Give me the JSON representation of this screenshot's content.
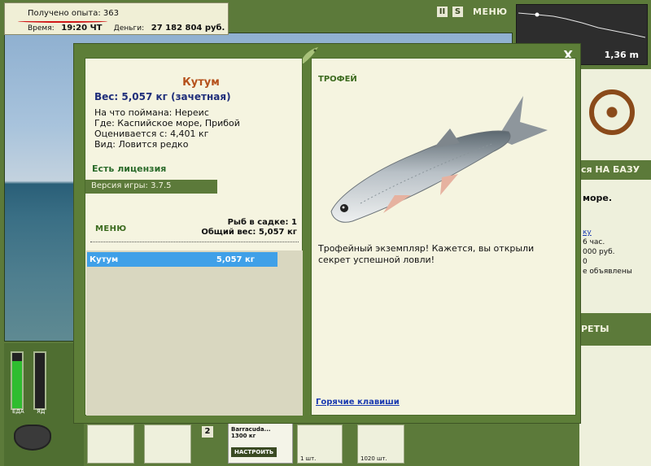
{
  "status": {
    "xp_text": "Получено опыта: 363",
    "time_label": "Время:",
    "time_value": "19:20 ЧТ",
    "money_label": "Деньги:",
    "money_value": "27 182 804 руб."
  },
  "top_menu": {
    "pause_icon": "pause-icon",
    "s_label": "S",
    "menu_label": "МЕНЮ"
  },
  "depth": {
    "value": "1,36 m"
  },
  "right_panel": {
    "base_label": "ся НА БАЗУ",
    "sea_text": "море.",
    "line1": "ку",
    "line2": "6 час.",
    "line3": "000 руб.",
    "line4": "0",
    "line5": "е объявлены",
    "secrets_label": "РЕТЫ"
  },
  "gauges": {
    "food_label": "ЕДА",
    "poison_label": "ЯД",
    "food_fill": 0.85,
    "poison_fill": 0.0
  },
  "bottom_bar": {
    "slot_num": "2",
    "tackle_name": "Barracuda...",
    "tackle_weight": "1300 кг",
    "setup_button": "НАСТРОИТЬ",
    "hook_count": "1 шт.",
    "bait_count": "1020 шт."
  },
  "modal": {
    "close_label": "X",
    "fish_name": "Кутум",
    "fish_weight": "Вес: 5,057 кг (зачетная)",
    "caught_on": "На что поймана: Нереис",
    "location": "Где: Каспийское море, Прибой",
    "valued_from": "Оценивается с: 4,401 кг",
    "species": "Вид: Ловится редко",
    "license": "Есть лицензия",
    "version": "Версия игры: 3.7.5",
    "menu_label": "МЕНЮ",
    "fish_in_cage": "Рыб в садке: 1",
    "total_weight": "Общий вес: 5,057 кг",
    "catch_list": [
      {
        "name": "Кутум",
        "weight": "5,057 кг"
      }
    ],
    "trophy_label": "ТРОФЕЙ",
    "trophy_message": "Трофейный экземпляр! Кажется, вы открыли секрет успешной ловли!",
    "hotkeys": "Горячие клавиши"
  },
  "colors": {
    "accent_green": "#5c7a3a",
    "title_orange": "#b5511c",
    "weight_blue": "#1f2e7a",
    "selection_blue": "#3fa0e8"
  }
}
